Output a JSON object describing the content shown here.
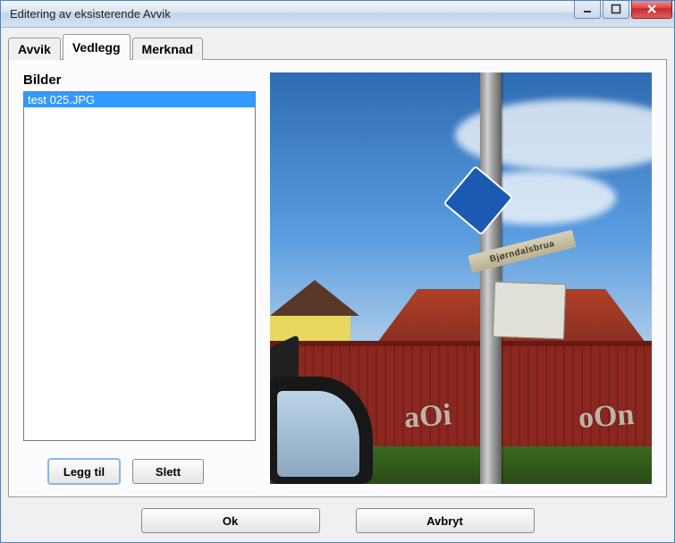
{
  "window": {
    "title": "Editering av eksisterende Avvik"
  },
  "tabs": {
    "items": [
      {
        "label": "Avvik",
        "active": false
      },
      {
        "label": "Vedlegg",
        "active": true
      },
      {
        "label": "Merknad",
        "active": false
      }
    ]
  },
  "section": {
    "bilder_label": "Bilder"
  },
  "list": {
    "items": [
      {
        "name": "test 025.JPG",
        "selected": true
      }
    ]
  },
  "buttons": {
    "add": "Legg til",
    "delete": "Slett",
    "ok": "Ok",
    "cancel": "Avbryt"
  },
  "preview": {
    "street_sign_text": "Bjørndalsbrua"
  }
}
